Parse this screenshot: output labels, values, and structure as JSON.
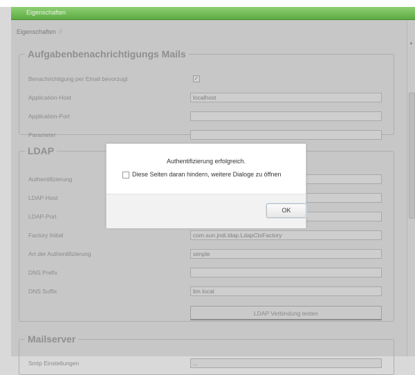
{
  "window": {
    "title": "Eigenschaften"
  },
  "breadcrumb": {
    "label": "Eigenschaften",
    "separator": "//"
  },
  "sections": {
    "mail": {
      "legend": "Aufgabenbenachrichtigungs Mails",
      "rows": [
        {
          "label": "Benachrichtigung per Email bevorzugt",
          "type": "checkbox",
          "checked": true
        },
        {
          "label": "Application-Host",
          "type": "text",
          "value": "localhost"
        },
        {
          "label": "Application-Port",
          "type": "text",
          "value": ""
        },
        {
          "label": "Parameter",
          "type": "text",
          "value": ""
        }
      ]
    },
    "ldap": {
      "legend": "LDAP",
      "rows": [
        {
          "label": "Authentifizierung",
          "type": "text",
          "value": ""
        },
        {
          "label": "LDAP-Host",
          "type": "text",
          "value": ""
        },
        {
          "label": "LDAP-Port",
          "type": "text",
          "value": ""
        },
        {
          "label": "Factory Initial",
          "type": "text",
          "value": "com.sun.jndi.ldap.LdapCtxFactory"
        },
        {
          "label": "Art der Authentifizierung",
          "type": "text",
          "value": "simple"
        },
        {
          "label": "DNS Prefix",
          "type": "text",
          "value": ""
        },
        {
          "label": "DNS Suffix",
          "type": "text",
          "value": "lim.local"
        }
      ],
      "test_button": "LDAP Verbindung testen"
    },
    "mailserver": {
      "legend": "Mailserver",
      "rows": [
        {
          "label": "Smtp Einstellungen",
          "type": "text",
          "value": "..."
        }
      ]
    }
  },
  "dialog": {
    "message": "Authentifizierung erfolgreich.",
    "checkbox_label": "Diese Seiten daran hindern, weitere Dialoge zu öffnen",
    "checkbox_checked": false,
    "ok_label": "OK"
  },
  "colors": {
    "title_bar": "#5cab43",
    "background": "#c7c7c7",
    "dialog_bg": "#ffffff"
  }
}
